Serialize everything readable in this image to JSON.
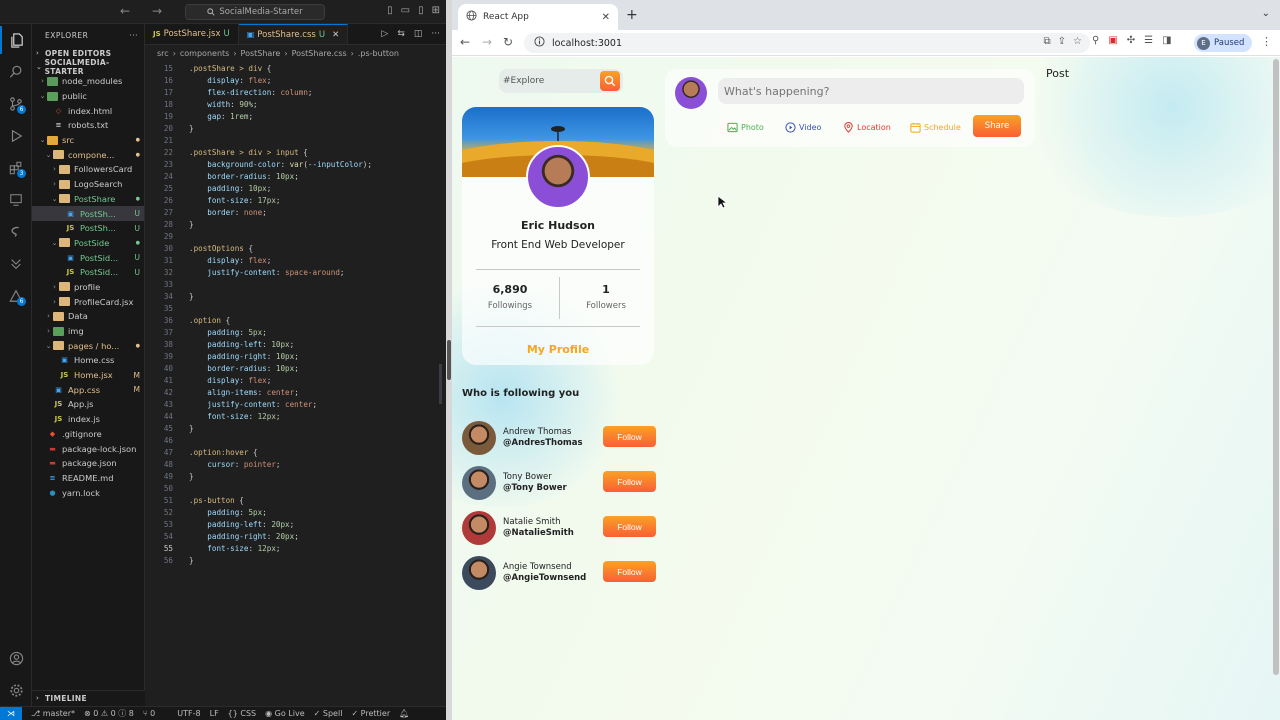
{
  "vscode": {
    "search_text": "SocialMedia-Starter",
    "explorer_title": "EXPLORER",
    "open_editors": "OPEN EDITORS",
    "project": "SOCIALMEDIA-STARTER",
    "timeline": "TIMELINE",
    "badges": {
      "source_control": "6",
      "extensions": "3"
    },
    "tree": [
      {
        "name": "node_modules",
        "depth": 1,
        "kind": "folder",
        "variant": "nm",
        "chev": "›",
        "status": ""
      },
      {
        "name": "public",
        "depth": 1,
        "kind": "folder",
        "variant": "pub",
        "chev": "⌄",
        "status": ""
      },
      {
        "name": "index.html",
        "depth": 2,
        "kind": "html",
        "status": ""
      },
      {
        "name": "robots.txt",
        "depth": 2,
        "kind": "txt",
        "status": ""
      },
      {
        "name": "src",
        "depth": 1,
        "kind": "folder",
        "variant": "src",
        "chev": "⌄",
        "status": "dot",
        "color": "#e2c08d"
      },
      {
        "name": "compone...",
        "depth": 2,
        "kind": "folder",
        "chev": "⌄",
        "status": "dot",
        "color": "#e2c08d"
      },
      {
        "name": "FollowersCard",
        "depth": 3,
        "kind": "folder",
        "chev": "›",
        "status": ""
      },
      {
        "name": "LogoSearch",
        "depth": 3,
        "kind": "folder",
        "chev": "›",
        "status": ""
      },
      {
        "name": "PostShare",
        "depth": 3,
        "kind": "folder",
        "chev": "⌄",
        "status": "dot",
        "color": "#73c991"
      },
      {
        "name": "PostSh...",
        "depth": 4,
        "kind": "css",
        "status": "U",
        "color": "#73c991",
        "selected": true
      },
      {
        "name": "PostSh...",
        "depth": 4,
        "kind": "js",
        "status": "U",
        "color": "#73c991"
      },
      {
        "name": "PostSide",
        "depth": 3,
        "kind": "folder",
        "chev": "⌄",
        "status": "dot",
        "color": "#73c991"
      },
      {
        "name": "PostSid...",
        "depth": 4,
        "kind": "css",
        "status": "U",
        "color": "#73c991"
      },
      {
        "name": "PostSid...",
        "depth": 4,
        "kind": "js",
        "status": "U",
        "color": "#73c991"
      },
      {
        "name": "profile",
        "depth": 3,
        "kind": "folder",
        "chev": "›",
        "status": ""
      },
      {
        "name": "ProfileCard.jsx",
        "depth": 3,
        "kind": "folder",
        "chev": "›",
        "status": ""
      },
      {
        "name": "Data",
        "depth": 2,
        "kind": "folder",
        "chev": "›",
        "status": ""
      },
      {
        "name": "img",
        "depth": 2,
        "kind": "folder",
        "variant": "pub",
        "chev": "›",
        "status": ""
      },
      {
        "name": "pages / ho...",
        "depth": 2,
        "kind": "folder",
        "chev": "⌄",
        "status": "dot",
        "color": "#e2c08d"
      },
      {
        "name": "Home.css",
        "depth": 3,
        "kind": "css",
        "status": ""
      },
      {
        "name": "Home.jsx",
        "depth": 3,
        "kind": "js",
        "status": "M",
        "color": "#e2c08d"
      },
      {
        "name": "App.css",
        "depth": 2,
        "kind": "css",
        "status": "M",
        "color": "#e2c08d"
      },
      {
        "name": "App.js",
        "depth": 2,
        "kind": "js",
        "status": ""
      },
      {
        "name": "index.js",
        "depth": 2,
        "kind": "js",
        "status": ""
      },
      {
        "name": ".gitignore",
        "depth": 1,
        "kind": "git",
        "status": ""
      },
      {
        "name": "package-lock.json",
        "depth": 1,
        "kind": "npm",
        "status": ""
      },
      {
        "name": "package.json",
        "depth": 1,
        "kind": "npm",
        "status": ""
      },
      {
        "name": "README.md",
        "depth": 1,
        "kind": "md",
        "status": ""
      },
      {
        "name": "yarn.lock",
        "depth": 1,
        "kind": "yarn",
        "status": ""
      }
    ],
    "tabs": [
      {
        "label": "PostShare.jsx",
        "kind": "js",
        "status": "U",
        "active": false
      },
      {
        "label": "PostShare.css",
        "kind": "css",
        "status": "U",
        "active": true
      }
    ],
    "breadcrumb": [
      "src",
      "components",
      "PostShare",
      "PostShare.css",
      ".ps-button"
    ],
    "current_line": 55,
    "code": [
      {
        "n": 15,
        "t": [
          [
            "c-sel",
            ".postShare > div "
          ],
          [
            "c-pun",
            "{"
          ]
        ]
      },
      {
        "n": 16,
        "t": [
          [
            "c-pun",
            "    "
          ],
          [
            "c-prop",
            "display"
          ],
          [
            "c-pun",
            ": "
          ],
          [
            "c-val",
            "flex"
          ],
          [
            "c-pun",
            ";"
          ]
        ]
      },
      {
        "n": 17,
        "t": [
          [
            "c-pun",
            "    "
          ],
          [
            "c-prop",
            "flex-direction"
          ],
          [
            "c-pun",
            ": "
          ],
          [
            "c-val",
            "column"
          ],
          [
            "c-pun",
            ";"
          ]
        ]
      },
      {
        "n": 18,
        "t": [
          [
            "c-pun",
            "    "
          ],
          [
            "c-prop",
            "width"
          ],
          [
            "c-pun",
            ": "
          ],
          [
            "c-num",
            "90%"
          ],
          [
            "c-pun",
            ";"
          ]
        ]
      },
      {
        "n": 19,
        "t": [
          [
            "c-pun",
            "    "
          ],
          [
            "c-prop",
            "gap"
          ],
          [
            "c-pun",
            ": "
          ],
          [
            "c-num",
            "1rem"
          ],
          [
            "c-pun",
            ";"
          ]
        ]
      },
      {
        "n": 20,
        "t": [
          [
            "c-pun",
            "}"
          ]
        ]
      },
      {
        "n": 21,
        "t": []
      },
      {
        "n": 22,
        "t": [
          [
            "c-sel",
            ".postShare > div > input "
          ],
          [
            "c-pun",
            "{"
          ]
        ]
      },
      {
        "n": 23,
        "t": [
          [
            "c-pun",
            "    "
          ],
          [
            "c-prop",
            "background-color"
          ],
          [
            "c-pun",
            ": "
          ],
          [
            "c-fn",
            "var"
          ],
          [
            "c-pun",
            "("
          ],
          [
            "c-var",
            "--inputColor"
          ],
          [
            "c-pun",
            ");"
          ]
        ]
      },
      {
        "n": 24,
        "t": [
          [
            "c-pun",
            "    "
          ],
          [
            "c-prop",
            "border-radius"
          ],
          [
            "c-pun",
            ": "
          ],
          [
            "c-num",
            "10px"
          ],
          [
            "c-pun",
            ";"
          ]
        ]
      },
      {
        "n": 25,
        "t": [
          [
            "c-pun",
            "    "
          ],
          [
            "c-prop",
            "padding"
          ],
          [
            "c-pun",
            ": "
          ],
          [
            "c-num",
            "10px"
          ],
          [
            "c-pun",
            ";"
          ]
        ]
      },
      {
        "n": 26,
        "t": [
          [
            "c-pun",
            "    "
          ],
          [
            "c-prop",
            "font-size"
          ],
          [
            "c-pun",
            ": "
          ],
          [
            "c-num",
            "17px"
          ],
          [
            "c-pun",
            ";"
          ]
        ]
      },
      {
        "n": 27,
        "t": [
          [
            "c-pun",
            "    "
          ],
          [
            "c-prop",
            "border"
          ],
          [
            "c-pun",
            ": "
          ],
          [
            "c-val",
            "none"
          ],
          [
            "c-pun",
            ";"
          ]
        ]
      },
      {
        "n": 28,
        "t": [
          [
            "c-pun",
            "}"
          ]
        ]
      },
      {
        "n": 29,
        "t": []
      },
      {
        "n": 30,
        "t": [
          [
            "c-sel",
            ".postOptions "
          ],
          [
            "c-pun",
            "{"
          ]
        ]
      },
      {
        "n": 31,
        "t": [
          [
            "c-pun",
            "    "
          ],
          [
            "c-prop",
            "display"
          ],
          [
            "c-pun",
            ": "
          ],
          [
            "c-val",
            "flex"
          ],
          [
            "c-pun",
            ";"
          ]
        ]
      },
      {
        "n": 32,
        "t": [
          [
            "c-pun",
            "    "
          ],
          [
            "c-prop",
            "justify-content"
          ],
          [
            "c-pun",
            ": "
          ],
          [
            "c-val",
            "space-around"
          ],
          [
            "c-pun",
            ";"
          ]
        ]
      },
      {
        "n": 33,
        "t": []
      },
      {
        "n": 34,
        "t": [
          [
            "c-pun",
            "}"
          ]
        ]
      },
      {
        "n": 35,
        "t": []
      },
      {
        "n": 36,
        "t": [
          [
            "c-sel",
            ".option "
          ],
          [
            "c-pun",
            "{"
          ]
        ]
      },
      {
        "n": 37,
        "t": [
          [
            "c-pun",
            "    "
          ],
          [
            "c-prop",
            "padding"
          ],
          [
            "c-pun",
            ": "
          ],
          [
            "c-num",
            "5px"
          ],
          [
            "c-pun",
            ";"
          ]
        ]
      },
      {
        "n": 38,
        "t": [
          [
            "c-pun",
            "    "
          ],
          [
            "c-prop",
            "padding-left"
          ],
          [
            "c-pun",
            ": "
          ],
          [
            "c-num",
            "10px"
          ],
          [
            "c-pun",
            ";"
          ]
        ]
      },
      {
        "n": 39,
        "t": [
          [
            "c-pun",
            "    "
          ],
          [
            "c-prop",
            "padding-right"
          ],
          [
            "c-pun",
            ": "
          ],
          [
            "c-num",
            "10px"
          ],
          [
            "c-pun",
            ";"
          ]
        ]
      },
      {
        "n": 40,
        "t": [
          [
            "c-pun",
            "    "
          ],
          [
            "c-prop",
            "border-radius"
          ],
          [
            "c-pun",
            ": "
          ],
          [
            "c-num",
            "10px"
          ],
          [
            "c-pun",
            ";"
          ]
        ]
      },
      {
        "n": 41,
        "t": [
          [
            "c-pun",
            "    "
          ],
          [
            "c-prop",
            "display"
          ],
          [
            "c-pun",
            ": "
          ],
          [
            "c-val",
            "flex"
          ],
          [
            "c-pun",
            ";"
          ]
        ]
      },
      {
        "n": 42,
        "t": [
          [
            "c-pun",
            "    "
          ],
          [
            "c-prop",
            "align-items"
          ],
          [
            "c-pun",
            ": "
          ],
          [
            "c-val",
            "center"
          ],
          [
            "c-pun",
            ";"
          ]
        ]
      },
      {
        "n": 43,
        "t": [
          [
            "c-pun",
            "    "
          ],
          [
            "c-prop",
            "justify-content"
          ],
          [
            "c-pun",
            ": "
          ],
          [
            "c-val",
            "center"
          ],
          [
            "c-pun",
            ";"
          ]
        ]
      },
      {
        "n": 44,
        "t": [
          [
            "c-pun",
            "    "
          ],
          [
            "c-prop",
            "font-size"
          ],
          [
            "c-pun",
            ": "
          ],
          [
            "c-num",
            "12px"
          ],
          [
            "c-pun",
            ";"
          ]
        ]
      },
      {
        "n": 45,
        "t": [
          [
            "c-pun",
            "}"
          ]
        ]
      },
      {
        "n": 46,
        "t": []
      },
      {
        "n": 47,
        "t": [
          [
            "c-sel",
            ".option:hover "
          ],
          [
            "c-pun",
            "{"
          ]
        ]
      },
      {
        "n": 48,
        "t": [
          [
            "c-pun",
            "    "
          ],
          [
            "c-prop",
            "cursor"
          ],
          [
            "c-pun",
            ": "
          ],
          [
            "c-val",
            "pointer"
          ],
          [
            "c-pun",
            ";"
          ]
        ]
      },
      {
        "n": 49,
        "t": [
          [
            "c-pun",
            "}"
          ]
        ]
      },
      {
        "n": 50,
        "t": []
      },
      {
        "n": 51,
        "t": [
          [
            "c-sel",
            ".ps-button "
          ],
          [
            "c-pun",
            "{"
          ]
        ]
      },
      {
        "n": 52,
        "t": [
          [
            "c-pun",
            "    "
          ],
          [
            "c-prop",
            "padding"
          ],
          [
            "c-pun",
            ": "
          ],
          [
            "c-num",
            "5px"
          ],
          [
            "c-pun",
            ";"
          ]
        ]
      },
      {
        "n": 53,
        "t": [
          [
            "c-pun",
            "    "
          ],
          [
            "c-prop",
            "padding-left"
          ],
          [
            "c-pun",
            ": "
          ],
          [
            "c-num",
            "20px"
          ],
          [
            "c-pun",
            ";"
          ]
        ]
      },
      {
        "n": 54,
        "t": [
          [
            "c-pun",
            "    "
          ],
          [
            "c-prop",
            "padding-right"
          ],
          [
            "c-pun",
            ": "
          ],
          [
            "c-num",
            "20px"
          ],
          [
            "c-pun",
            ";"
          ]
        ]
      },
      {
        "n": 55,
        "t": [
          [
            "c-pun",
            "    "
          ],
          [
            "c-prop",
            "font-size"
          ],
          [
            "c-pun",
            ": "
          ],
          [
            "c-num",
            "12px"
          ],
          [
            "c-pun",
            ";"
          ]
        ]
      },
      {
        "n": 56,
        "t": [
          [
            "c-pun",
            "}"
          ]
        ]
      }
    ],
    "status": {
      "branch": "master*",
      "problems": "⊗ 0 ⚠ 0 ⓘ 8",
      "ports": "⑂ 0",
      "encoding": "UTF-8",
      "eol": "LF",
      "language": "{} CSS",
      "golive": "Go Live",
      "spell": "✓ Spell",
      "prettier": "✓ Prettier"
    }
  },
  "browser": {
    "tab_title": "React App",
    "url": "localhost:3001",
    "paused": "Paused",
    "profile_initial": "E",
    "accent_color": "#f95f35"
  },
  "app": {
    "search_placeholder": "#Explore",
    "profile": {
      "name": "Eric Hudson",
      "title": "Front End Web Developer",
      "followings_count": "6,890",
      "followings_label": "Followings",
      "followers_count": "1",
      "followers_label": "Followers",
      "my_profile": "My Profile"
    },
    "who_following_title": "Who is following you",
    "follow_label": "Follow",
    "followers": [
      {
        "name": "Andrew Thomas",
        "username": "@AndresThomas",
        "color": "#7a5a3a"
      },
      {
        "name": "Tony Bower",
        "username": "@Tony Bower",
        "color": "#5b6f80"
      },
      {
        "name": "Natalie Smith",
        "username": "@NatalieSmith",
        "color": "#b03a3a"
      },
      {
        "name": "Angie Townsend",
        "username": "@AngieTownsend",
        "color": "#3c4a5e"
      }
    ],
    "share": {
      "placeholder": "What's happening?",
      "options": [
        {
          "label": "Photo",
          "icon": "photo-icon",
          "color": "#4caf50"
        },
        {
          "label": "Video",
          "icon": "video-icon",
          "color": "#3f51b5"
        },
        {
          "label": "Location",
          "icon": "location-icon",
          "color": "#e53935"
        },
        {
          "label": "Schedule",
          "icon": "schedule-icon",
          "color": "#f5a623"
        }
      ],
      "share_label": "Share"
    },
    "post_heading": "Post"
  }
}
